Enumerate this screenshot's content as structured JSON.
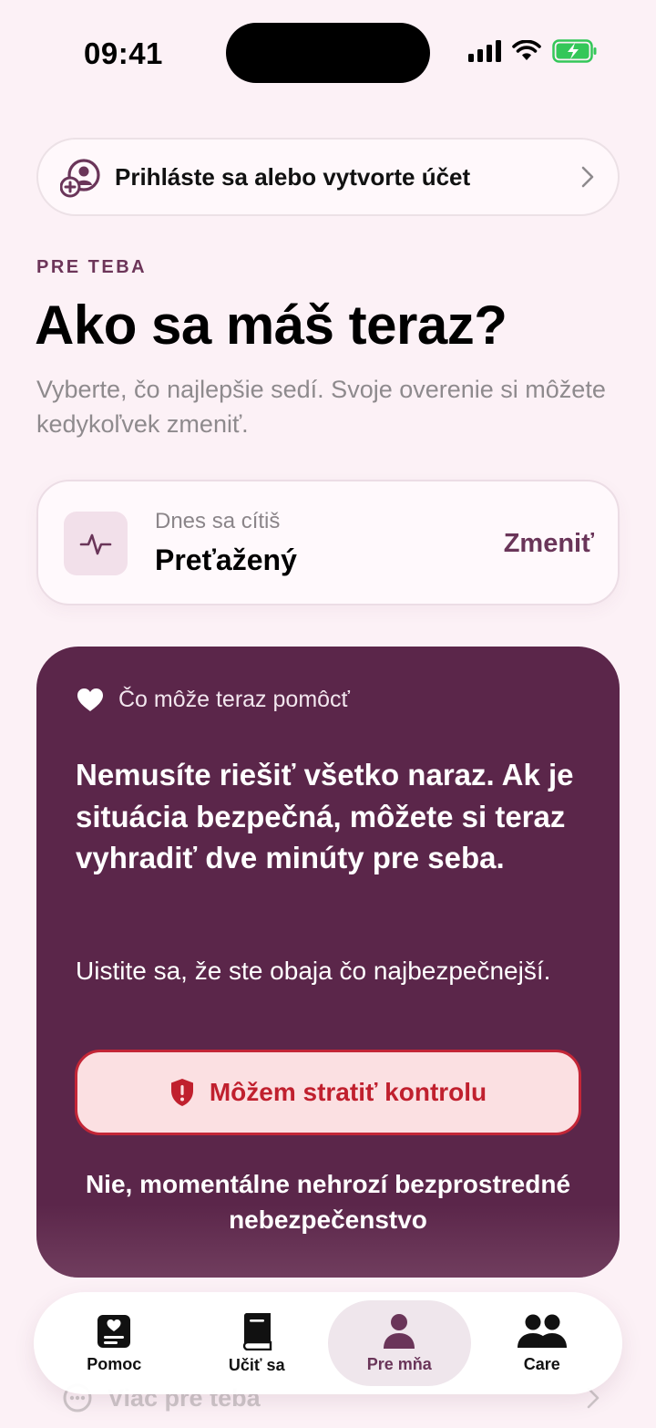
{
  "status_bar": {
    "time": "09:41"
  },
  "signin": {
    "label": "Prihláste sa alebo vytvorte účet"
  },
  "section": {
    "label": "PRE TEBA",
    "title": "Ako sa máš teraz?",
    "subtitle": "Vyberte, čo najlepšie sedí. Svoje overenie si môžete kedykoľvek zmeniť."
  },
  "mood": {
    "caption": "Dnes sa cítiš",
    "value": "Preťažený",
    "change_label": "Zmeniť"
  },
  "help": {
    "header": "Čo môže teraz pomôcť",
    "body": "Nemusíte riešiť všetko naraz. Ak je situácia bezpečná, môžete si teraz vyhradiť dve minúty pre seba.",
    "note": "Uistite sa, že ste obaja čo najbezpečnejší.",
    "danger_button": "Môžem stratiť kontrolu",
    "safe_link": "Nie, momentálne nehrozí bezprostredné nebezpečenstvo"
  },
  "more_row": {
    "label": "Viac pre teba"
  },
  "tabs": [
    {
      "label": "Pomoc",
      "icon": "heart-note-icon",
      "active": false
    },
    {
      "label": "Učiť sa",
      "icon": "book-icon",
      "active": false
    },
    {
      "label": "Pre mňa",
      "icon": "person-icon",
      "active": true
    },
    {
      "label": "Care",
      "icon": "people-icon",
      "active": false
    }
  ],
  "colors": {
    "background": "#fcf1f6",
    "accent": "#6a3559",
    "card_dark": "#5b264a",
    "danger": "#c0202e",
    "danger_bg": "#fbe0e2",
    "battery": "#34c759"
  }
}
